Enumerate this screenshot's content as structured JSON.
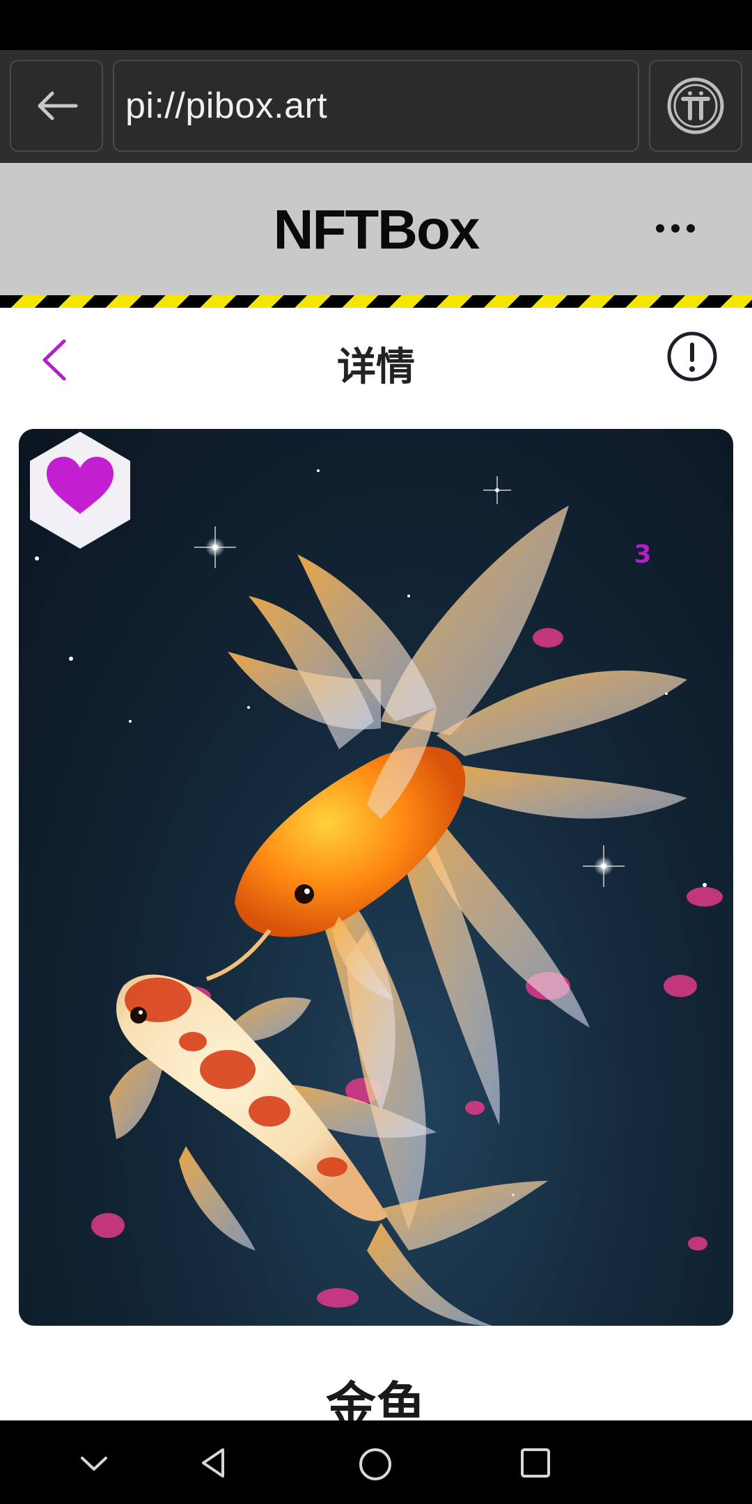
{
  "browser": {
    "url": "pi://pibox.art",
    "back_icon": "arrow-left-icon",
    "pi_icon": "pi-network-icon"
  },
  "app": {
    "title": "NFTBox",
    "menu_icon": "more-horizontal-icon"
  },
  "page": {
    "title": "详情",
    "back_icon": "chevron-left-icon",
    "info_icon": "info-circle-icon",
    "accent": "#b01fc7"
  },
  "artwork": {
    "likes": "3",
    "like_icon": "heart-icon"
  },
  "item": {
    "name": "金鱼"
  },
  "system_nav": {
    "items": [
      "chevron-down-icon",
      "back-triangle-icon",
      "home-circle-icon",
      "recents-square-icon"
    ]
  }
}
